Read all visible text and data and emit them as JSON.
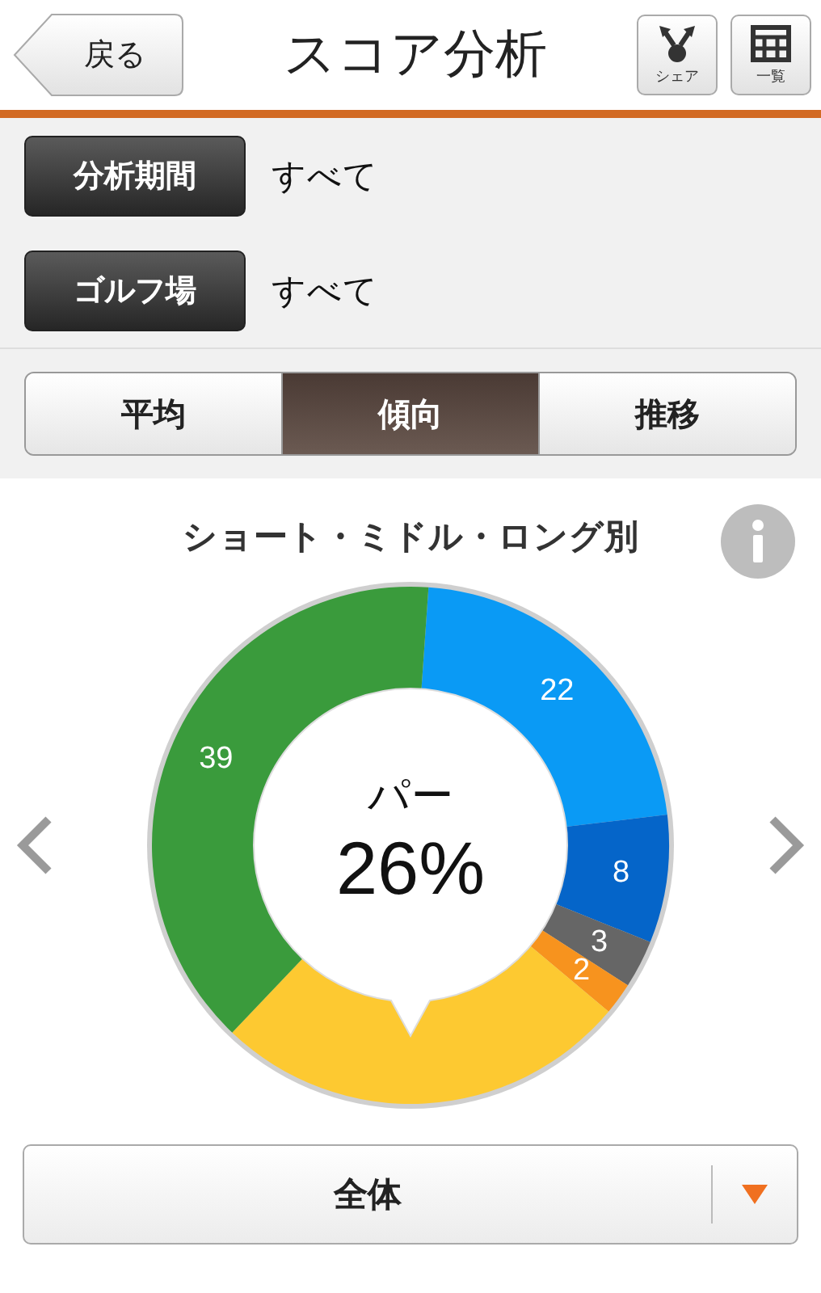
{
  "header": {
    "back_button": "戻る",
    "title": "スコア分析",
    "actions": [
      {
        "kind": "share",
        "label": "シェア"
      },
      {
        "kind": "list",
        "label": "一覧"
      }
    ]
  },
  "filters": [
    {
      "label": "分析期間",
      "value": "すべて"
    },
    {
      "label": "ゴルフ場",
      "value": "すべて"
    }
  ],
  "tabs": [
    {
      "label": "平均",
      "selected": false
    },
    {
      "label": "傾向",
      "selected": true
    },
    {
      "label": "推移",
      "selected": false
    }
  ],
  "chart": {
    "title": "ショート・ミドル・ロング別",
    "center_label": "パー",
    "center_value": "26%",
    "chart_data": {
      "type": "donut",
      "values": [
        22,
        8,
        3,
        2,
        26,
        39
      ],
      "value_labels": [
        "22",
        "8",
        "3",
        "2",
        null,
        "39"
      ],
      "colors": [
        "#0a9af5",
        "#0565c9",
        "#666666",
        "#f7931e",
        "#fdc931",
        "#3a9b3c"
      ]
    }
  },
  "dropdown": {
    "value": "全体"
  }
}
